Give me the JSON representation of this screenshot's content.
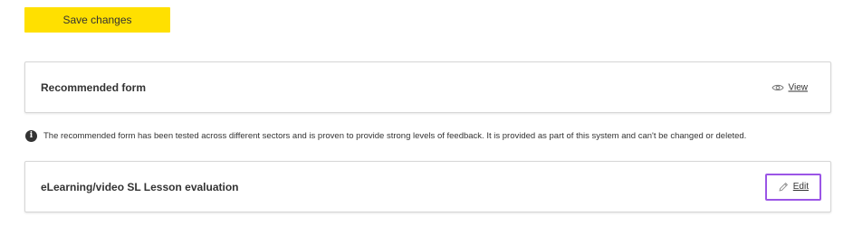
{
  "toolbar": {
    "save_label": "Save changes",
    "save_color": "#ffe000"
  },
  "recommended_card": {
    "title": "Recommended form",
    "action_label": "View",
    "action_icon": "eye-icon"
  },
  "info": {
    "icon": "info-icon",
    "icon_glyph": "i",
    "text": "The recommended form has been tested across different sectors and is proven to provide strong levels of feedback. It is provided as part of this system and can't be changed or deleted."
  },
  "lesson_card": {
    "title": "eLearning/video SL Lesson evaluation",
    "action_label": "Edit",
    "action_icon": "pencil-icon",
    "highlight_color": "#9b55e6"
  }
}
